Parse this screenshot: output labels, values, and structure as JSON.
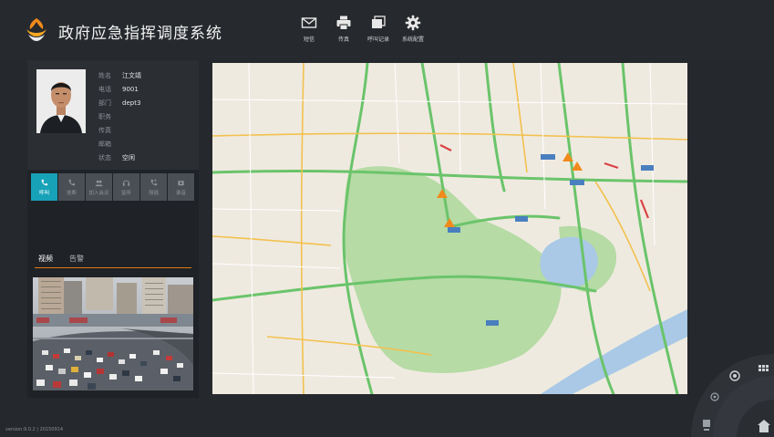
{
  "app": {
    "title": "政府应急指挥调度系统"
  },
  "toolbar": [
    {
      "label": "短信",
      "icon": "mail-icon"
    },
    {
      "label": "传真",
      "icon": "printer-icon"
    },
    {
      "label": "呼叫记录",
      "icon": "records-icon"
    },
    {
      "label": "系统配置",
      "icon": "gear-icon"
    }
  ],
  "contact": {
    "fields": [
      {
        "label": "姓名",
        "value": "江文靖"
      },
      {
        "label": "电话",
        "value": "9001"
      },
      {
        "label": "部门",
        "value": "dept3"
      },
      {
        "label": "职务",
        "value": ""
      },
      {
        "label": "传真",
        "value": ""
      },
      {
        "label": "邮箱",
        "value": ""
      },
      {
        "label": "状态",
        "value": "空闲"
      }
    ]
  },
  "call_actions": [
    {
      "label": "呼叫",
      "active": true
    },
    {
      "label": "挂断",
      "active": false
    },
    {
      "label": "加入会议",
      "active": false
    },
    {
      "label": "监听",
      "active": false
    },
    {
      "label": "强插",
      "active": false
    },
    {
      "label": "录音",
      "active": false
    }
  ],
  "tabs": [
    {
      "label": "视频",
      "active": true
    },
    {
      "label": "告警",
      "active": false
    }
  ],
  "footer": {
    "version": "version:9.0.2  |  20150914"
  },
  "colors": {
    "accent": "#17a2b8",
    "tab_underline": "#e07a12",
    "background": "#25282c",
    "park_green": "#b6dba5",
    "lake_blue": "#a9c9e6"
  }
}
